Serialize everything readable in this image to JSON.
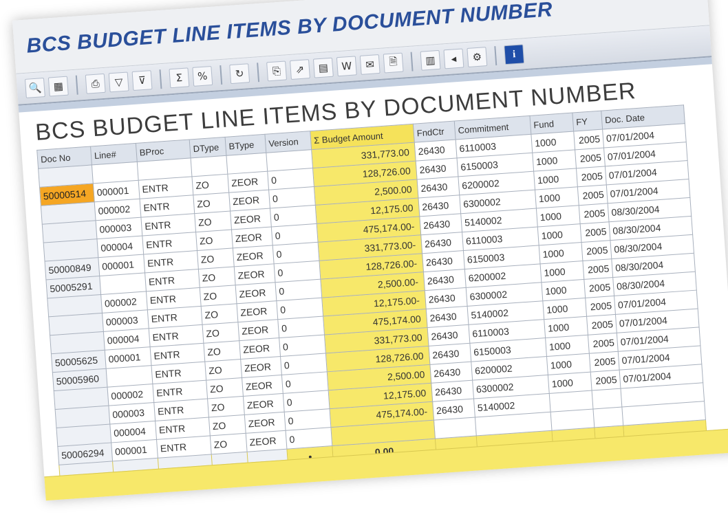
{
  "window": {
    "title": "BCS BUDGET LINE ITEMS BY DOCUMENT NUMBER"
  },
  "toolbar": {
    "groups": [
      [
        {
          "icon": "details-icon",
          "glyph": "🔍"
        },
        {
          "icon": "layout-icon",
          "glyph": "▦"
        }
      ],
      [
        {
          "icon": "print-icon",
          "glyph": "⎙"
        },
        {
          "icon": "filter-icon",
          "glyph": "▽"
        },
        {
          "icon": "filter-delete-icon",
          "glyph": "⊽"
        }
      ],
      [
        {
          "icon": "sum-icon",
          "glyph": "Σ"
        },
        {
          "icon": "subtotal-icon",
          "glyph": "%"
        }
      ],
      [
        {
          "icon": "refresh-icon",
          "glyph": "↻"
        }
      ],
      [
        {
          "icon": "copy-icon",
          "glyph": "⎘"
        },
        {
          "icon": "export-icon",
          "glyph": "⇗"
        },
        {
          "icon": "spreadsheet-icon",
          "glyph": "▤"
        },
        {
          "icon": "word-icon",
          "glyph": "W"
        },
        {
          "icon": "mail-icon",
          "glyph": "✉"
        },
        {
          "icon": "save-file-icon",
          "glyph": "🗎"
        }
      ],
      [
        {
          "icon": "graphic-icon",
          "glyph": "▥"
        },
        {
          "icon": "abc-icon",
          "glyph": "◂"
        },
        {
          "icon": "gear-icon",
          "glyph": "⚙"
        }
      ],
      [
        {
          "icon": "info-icon",
          "glyph": "i"
        }
      ]
    ]
  },
  "report": {
    "title": "BCS BUDGET LINE ITEMS BY DOCUMENT NUMBER"
  },
  "grid": {
    "columns": [
      "Doc No",
      "Line#",
      "BProc",
      "DType",
      "BType",
      "Version",
      "Σ Budget Amount",
      "FndCtr",
      "Commitment",
      "Fund",
      "FY",
      "Doc. Date"
    ],
    "rows": [
      [
        "",
        "",
        "",
        "",
        "",
        "",
        "331,773.00",
        "26430",
        "6110003",
        "1000",
        "2005",
        "07/01/2004"
      ],
      [
        "50000514",
        "000001",
        "ENTR",
        "ZO",
        "ZEOR",
        "0",
        "128,726.00",
        "26430",
        "6150003",
        "1000",
        "2005",
        "07/01/2004"
      ],
      [
        "",
        "000002",
        "ENTR",
        "ZO",
        "ZEOR",
        "0",
        "2,500.00",
        "26430",
        "6200002",
        "1000",
        "2005",
        "07/01/2004"
      ],
      [
        "",
        "000003",
        "ENTR",
        "ZO",
        "ZEOR",
        "0",
        "12,175.00",
        "26430",
        "6300002",
        "1000",
        "2005",
        "07/01/2004"
      ],
      [
        "",
        "000004",
        "ENTR",
        "ZO",
        "ZEOR",
        "0",
        "475,174.00-",
        "26430",
        "5140002",
        "1000",
        "2005",
        "08/30/2004"
      ],
      [
        "50000849",
        "000001",
        "ENTR",
        "ZO",
        "ZEOR",
        "0",
        "331,773.00-",
        "26430",
        "6110003",
        "1000",
        "2005",
        "08/30/2004"
      ],
      [
        "50005291",
        "",
        "ENTR",
        "ZO",
        "ZEOR",
        "0",
        "128,726.00-",
        "26430",
        "6150003",
        "1000",
        "2005",
        "08/30/2004"
      ],
      [
        "",
        "000002",
        "ENTR",
        "ZO",
        "ZEOR",
        "0",
        "2,500.00-",
        "26430",
        "6200002",
        "1000",
        "2005",
        "08/30/2004"
      ],
      [
        "",
        "000003",
        "ENTR",
        "ZO",
        "ZEOR",
        "0",
        "12,175.00-",
        "26430",
        "6300002",
        "1000",
        "2005",
        "08/30/2004"
      ],
      [
        "",
        "000004",
        "ENTR",
        "ZO",
        "ZEOR",
        "0",
        "475,174.00",
        "26430",
        "5140002",
        "1000",
        "2005",
        "07/01/2004"
      ],
      [
        "50005625",
        "000001",
        "ENTR",
        "ZO",
        "ZEOR",
        "0",
        "331,773.00",
        "26430",
        "6110003",
        "1000",
        "2005",
        "07/01/2004"
      ],
      [
        "50005960",
        "",
        "ENTR",
        "ZO",
        "ZEOR",
        "0",
        "128,726.00",
        "26430",
        "6150003",
        "1000",
        "2005",
        "07/01/2004"
      ],
      [
        "",
        "000002",
        "ENTR",
        "ZO",
        "ZEOR",
        "0",
        "2,500.00",
        "26430",
        "6200002",
        "1000",
        "2005",
        "07/01/2004"
      ],
      [
        "",
        "000003",
        "ENTR",
        "ZO",
        "ZEOR",
        "0",
        "12,175.00",
        "26430",
        "6300002",
        "1000",
        "2005",
        "07/01/2004"
      ],
      [
        "",
        "000004",
        "ENTR",
        "ZO",
        "ZEOR",
        "0",
        "475,174.00-",
        "26430",
        "5140002",
        "",
        "",
        ""
      ],
      [
        "50006294",
        "000001",
        "ENTR",
        "ZO",
        "ZEOR",
        "0",
        "",
        "",
        "",
        "",
        "",
        ""
      ]
    ],
    "highlighted_doc": "50000514",
    "total": {
      "marker": "•",
      "amount": "0.00"
    }
  },
  "colors": {
    "title_blue": "#2a4f9a",
    "amount_yellow": "#f7e86a",
    "selection_orange": "#f5a623"
  }
}
